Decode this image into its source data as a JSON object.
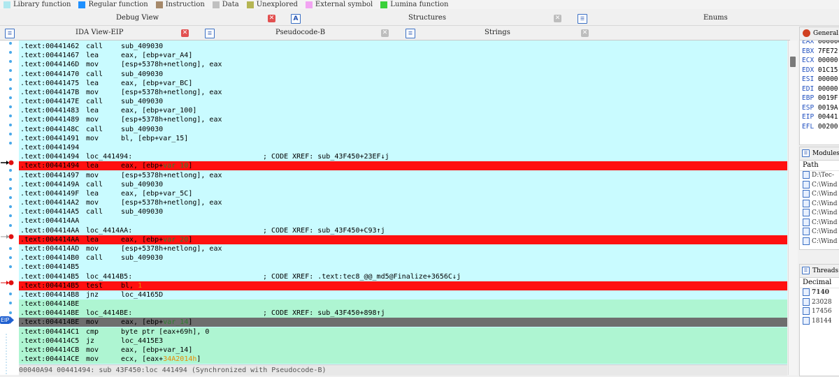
{
  "legend": [
    {
      "label": "Library function",
      "color": "#aee8ef"
    },
    {
      "label": "Regular function",
      "color": "#1e90ff"
    },
    {
      "label": "Instruction",
      "color": "#a6896a"
    },
    {
      "label": "Data",
      "color": "#c0c0c0"
    },
    {
      "label": "Unexplored",
      "color": "#b5b553"
    },
    {
      "label": "External symbol",
      "color": "#f2a4f2"
    },
    {
      "label": "Lumina function",
      "color": "#3bd13b"
    }
  ],
  "top_tabs": {
    "debug_view": "Debug View",
    "structures": "Structures",
    "enums": "Enums",
    "structures_icon": "A"
  },
  "sub_tabs": {
    "ida_view": "IDA View-EIP",
    "pseudocode": "Pseudocode-B",
    "strings": "Strings"
  },
  "close_glyph": "✕",
  "eip_label": "EIP",
  "code_lines": [
    {
      "addr": ".text:00441462",
      "mn": "call",
      "op": "sub_409030",
      "cm": "",
      "hl": "",
      "parts": [
        [
          "sub_409030",
          ""
        ]
      ]
    },
    {
      "addr": ".text:00441467",
      "mn": "lea",
      "op": "eax, [ebp+var_A4]",
      "cm": "",
      "hl": "",
      "parts": [
        [
          "eax, [ebp+var_A4]",
          ""
        ]
      ]
    },
    {
      "addr": ".text:0044146D",
      "mn": "mov",
      "op": "[esp+5378h+netlong], eax",
      "cm": "",
      "hl": "",
      "parts": [
        [
          "[esp+5378h+netlong], eax",
          ""
        ]
      ]
    },
    {
      "addr": ".text:00441470",
      "mn": "call",
      "op": "sub_409030",
      "cm": "",
      "hl": "",
      "parts": [
        [
          "sub_409030",
          ""
        ]
      ]
    },
    {
      "addr": ".text:00441475",
      "mn": "lea",
      "op": "eax, [ebp+var_BC]",
      "cm": "",
      "hl": "",
      "parts": [
        [
          "eax, [ebp+var_BC]",
          ""
        ]
      ]
    },
    {
      "addr": ".text:0044147B",
      "mn": "mov",
      "op": "[esp+5378h+netlong], eax",
      "cm": "",
      "hl": "",
      "parts": [
        [
          "[esp+5378h+netlong], eax",
          ""
        ]
      ]
    },
    {
      "addr": ".text:0044147E",
      "mn": "call",
      "op": "sub_409030",
      "cm": "",
      "hl": "",
      "parts": [
        [
          "sub_409030",
          ""
        ]
      ]
    },
    {
      "addr": ".text:00441483",
      "mn": "lea",
      "op": "eax, [ebp+var_100]",
      "cm": "",
      "hl": "",
      "parts": [
        [
          "eax, [ebp+var_100]",
          ""
        ]
      ]
    },
    {
      "addr": ".text:00441489",
      "mn": "mov",
      "op": "[esp+5378h+netlong], eax",
      "cm": "",
      "hl": "",
      "parts": [
        [
          "[esp+5378h+netlong], eax",
          ""
        ]
      ]
    },
    {
      "addr": ".text:0044148C",
      "mn": "call",
      "op": "sub_409030",
      "cm": "",
      "hl": "",
      "parts": [
        [
          "sub_409030",
          ""
        ]
      ]
    },
    {
      "addr": ".text:00441491",
      "mn": "mov",
      "op": "bl, [ebp+var_15]",
      "cm": "",
      "hl": "",
      "parts": [
        [
          "bl, [ebp+var_15]",
          ""
        ]
      ]
    },
    {
      "addr": ".text:00441494",
      "mn": "",
      "op": "",
      "cm": "",
      "hl": "",
      "parts": []
    },
    {
      "addr": ".text:00441494",
      "mn": "loc_441494:",
      "op": "",
      "cm": "; CODE XREF: sub_43F450+23EF↓j",
      "hl": "",
      "parts": []
    },
    {
      "addr": ".text:00441494",
      "mn": "lea",
      "op": "eax, [ebp+var_10]",
      "cm": "",
      "hl": "red",
      "parts": [
        [
          "eax, [ebp+",
          ""
        ],
        [
          "var_10",
          "var"
        ],
        [
          "]",
          ""
        ]
      ]
    },
    {
      "addr": ".text:00441497",
      "mn": "mov",
      "op": "[esp+5378h+netlong], eax",
      "cm": "",
      "hl": "",
      "parts": [
        [
          "[esp+5378h+netlong], eax",
          ""
        ]
      ]
    },
    {
      "addr": ".text:0044149A",
      "mn": "call",
      "op": "sub_409030",
      "cm": "",
      "hl": "",
      "parts": [
        [
          "sub_409030",
          ""
        ]
      ]
    },
    {
      "addr": ".text:0044149F",
      "mn": "lea",
      "op": "eax, [ebp+var_5C]",
      "cm": "",
      "hl": "",
      "parts": [
        [
          "eax, [ebp+var_5C]",
          ""
        ]
      ]
    },
    {
      "addr": ".text:004414A2",
      "mn": "mov",
      "op": "[esp+5378h+netlong], eax",
      "cm": "",
      "hl": "",
      "parts": [
        [
          "[esp+5378h+netlong], eax",
          ""
        ]
      ]
    },
    {
      "addr": ".text:004414A5",
      "mn": "call",
      "op": "sub_409030",
      "cm": "",
      "hl": "",
      "parts": [
        [
          "sub_409030",
          ""
        ]
      ]
    },
    {
      "addr": ".text:004414AA",
      "mn": "",
      "op": "",
      "cm": "",
      "hl": "",
      "parts": []
    },
    {
      "addr": ".text:004414AA",
      "mn": "loc_4414AA:",
      "op": "",
      "cm": "; CODE XREF: sub_43F450+C93↑j",
      "hl": "",
      "parts": []
    },
    {
      "addr": ".text:004414AA",
      "mn": "lea",
      "op": "eax, [ebp+var_20]",
      "cm": "",
      "hl": "red",
      "parts": [
        [
          "eax, [ebp+",
          ""
        ],
        [
          "var_20",
          "var"
        ],
        [
          "]",
          ""
        ]
      ]
    },
    {
      "addr": ".text:004414AD",
      "mn": "mov",
      "op": "[esp+5378h+netlong], eax",
      "cm": "",
      "hl": "",
      "parts": [
        [
          "[esp+5378h+netlong], eax",
          ""
        ]
      ]
    },
    {
      "addr": ".text:004414B0",
      "mn": "call",
      "op": "sub_409030",
      "cm": "",
      "hl": "",
      "parts": [
        [
          "sub_409030",
          ""
        ]
      ]
    },
    {
      "addr": ".text:004414B5",
      "mn": "",
      "op": "",
      "cm": "",
      "hl": "",
      "parts": []
    },
    {
      "addr": ".text:004414B5",
      "mn": "loc_4414B5:",
      "op": "",
      "cm": "; CODE XREF: .text:tec8_@@_md5@Finalize+3656C↓j",
      "hl": "",
      "parts": []
    },
    {
      "addr": ".text:004414B5",
      "mn": "test",
      "op": "bl, 1",
      "cm": "",
      "hl": "red",
      "parts": [
        [
          "bl, ",
          ""
        ],
        [
          "1",
          "num"
        ]
      ]
    },
    {
      "addr": ".text:004414B8",
      "mn": "jnz",
      "op": "loc_44165D",
      "cm": "",
      "hl": "",
      "parts": [
        [
          "loc_44165D",
          ""
        ]
      ]
    },
    {
      "addr": ".text:004414BE",
      "mn": "",
      "op": "",
      "cm": "",
      "hl": "green",
      "parts": []
    },
    {
      "addr": ".text:004414BE",
      "mn": "loc_4414BE:",
      "op": "",
      "cm": "; CODE XREF: sub_43F450+898↑j",
      "hl": "green",
      "parts": []
    },
    {
      "addr": ".text:004414BE",
      "mn": "mov",
      "op": "eax, [ebp+var_14]",
      "cm": "",
      "hl": "grey",
      "parts": [
        [
          "eax, [ebp+",
          ""
        ],
        [
          "var_14",
          "var"
        ],
        [
          "]",
          ""
        ]
      ]
    },
    {
      "addr": ".text:004414C1",
      "mn": "cmp",
      "op": "byte ptr [eax+69h], 0",
      "cm": "",
      "hl": "green",
      "parts": [
        [
          "byte ptr [eax+69h], 0",
          ""
        ]
      ]
    },
    {
      "addr": ".text:004414C5",
      "mn": "jz",
      "op": "loc_4415E3",
      "cm": "",
      "hl": "green",
      "parts": [
        [
          "loc_4415E3",
          ""
        ]
      ]
    },
    {
      "addr": ".text:004414CB",
      "mn": "mov",
      "op": "eax, [ebp+var_14]",
      "cm": "",
      "hl": "green",
      "parts": [
        [
          "eax, [ebp+var_14]",
          ""
        ]
      ]
    },
    {
      "addr": ".text:004414CE",
      "mn": "mov",
      "op": "ecx, [eax+34A2014h]",
      "cm": "",
      "hl": "green",
      "parts": [
        [
          "ecx, [eax+",
          ""
        ],
        [
          "34A2014h",
          "num"
        ],
        [
          "]",
          ""
        ]
      ]
    }
  ],
  "status_line": "00040A94 00441494: sub 43F450:loc 441494 (Synchronized with Pseudocode-B)",
  "registers": {
    "title": "General",
    "items": [
      {
        "name": "EAX",
        "value": "00000000"
      },
      {
        "name": "EBX",
        "value": "7FE72"
      },
      {
        "name": "ECX",
        "value": "00000"
      },
      {
        "name": "EDX",
        "value": "01C15"
      },
      {
        "name": "ESI",
        "value": "00000"
      },
      {
        "name": "EDI",
        "value": "00000"
      },
      {
        "name": "EBP",
        "value": "0019F"
      },
      {
        "name": "ESP",
        "value": "0019A"
      },
      {
        "name": "EIP",
        "value": "00441"
      },
      {
        "name": "EFL",
        "value": "00200"
      }
    ]
  },
  "modules": {
    "title": "Modules",
    "col_header": "Path",
    "items": [
      "D:\\Tec-",
      "C:\\Wind",
      "C:\\Wind",
      "C:\\Wind",
      "C:\\Wind",
      "C:\\Wind",
      "C:\\Wind",
      "C:\\Wind"
    ]
  },
  "threads": {
    "title": "Threads",
    "col_header": "Decimal",
    "items": [
      {
        "id": "7140",
        "bold": true
      },
      {
        "id": "23028",
        "bold": false
      },
      {
        "id": "17456",
        "bold": false
      },
      {
        "id": "18144",
        "bold": false
      }
    ]
  }
}
